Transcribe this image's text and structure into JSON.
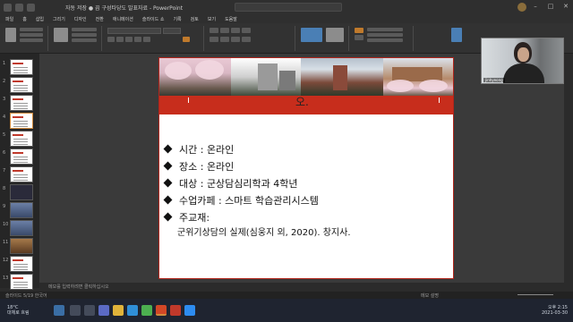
{
  "window": {
    "title": "자동 저장 ● 끔  구성타당도 발표자료 - PowerPoint",
    "autosave_label": "자동 저장"
  },
  "menu": [
    "파일",
    "홈",
    "삽입",
    "그리기",
    "디자인",
    "전환",
    "애니메이션",
    "슬라이드 쇼",
    "기록",
    "검토",
    "보기",
    "도움말"
  ],
  "slide": {
    "title_fragment": "오.",
    "bullets": [
      "시간 : 온라인",
      "장소 : 온라인",
      "대상 : 군상담심리학과 4학년",
      "수업카페 : 스마트 학습관리시스템",
      "주교재:"
    ],
    "subline": "군위기상담의 실제(심웅지 외, 2020). 창지사."
  },
  "thumbnails": [
    "1",
    "2",
    "3",
    "4",
    "5",
    "6",
    "7",
    "8",
    "9",
    "10",
    "11",
    "12",
    "13"
  ],
  "notes_placeholder": "메모를 입력하려면 클릭하십시오",
  "status": {
    "left": "슬라이드 5/19  한국어",
    "right": "메모  설명"
  },
  "taskbar": {
    "weather_temp": "18°C",
    "weather_desc": "대체로 흐림",
    "time": "오후 2:15",
    "date": "2021-03-30"
  },
  "webcam": {
    "name": "jinhyeong"
  },
  "colors": {
    "accent_red": "#c72d1c",
    "ribbon_bg": "#323232"
  }
}
